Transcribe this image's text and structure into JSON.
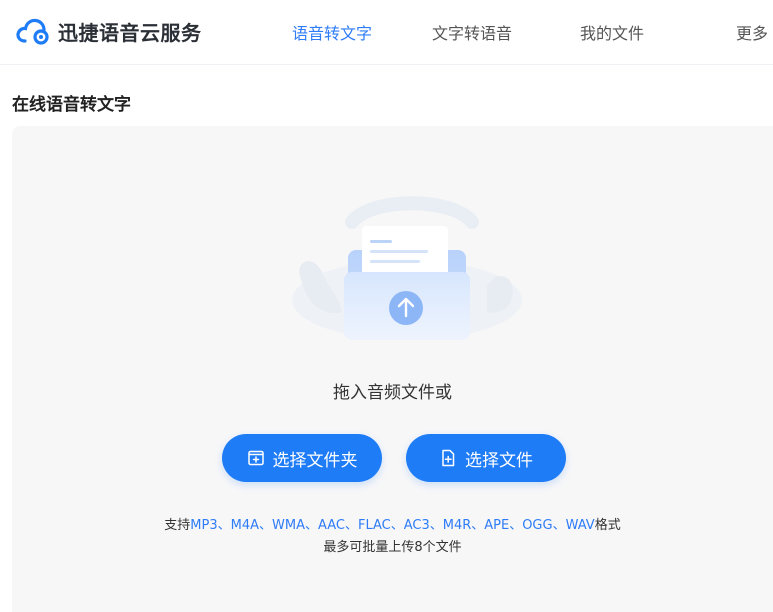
{
  "header": {
    "logo_text": "迅捷语音云服务",
    "nav": [
      {
        "label": "语音转文字",
        "active": true
      },
      {
        "label": "文字转语音",
        "active": false
      },
      {
        "label": "我的文件",
        "active": false
      },
      {
        "label": "更多",
        "active": false
      }
    ]
  },
  "main": {
    "title": "在线语音转文字",
    "drop_text": "拖入音频文件或",
    "buttons": {
      "select_folder": "选择文件夹",
      "select_file": "选择文件"
    },
    "formats_prefix": "支持",
    "formats_list": "MP3、M4A、WMA、AAC、FLAC、AC3、M4R、APE、OGG、WAV",
    "formats_suffix": "格式",
    "limit_text": "最多可批量上传8个文件"
  },
  "colors": {
    "accent": "#2e7cf6",
    "button": "#1f7cf7",
    "area_bg": "#f7f7f8"
  },
  "icons": {
    "logo": "cloud-logo-icon",
    "upload": "upload-arrow-icon",
    "folder_button": "folder-add-icon",
    "file_button": "file-add-icon"
  }
}
